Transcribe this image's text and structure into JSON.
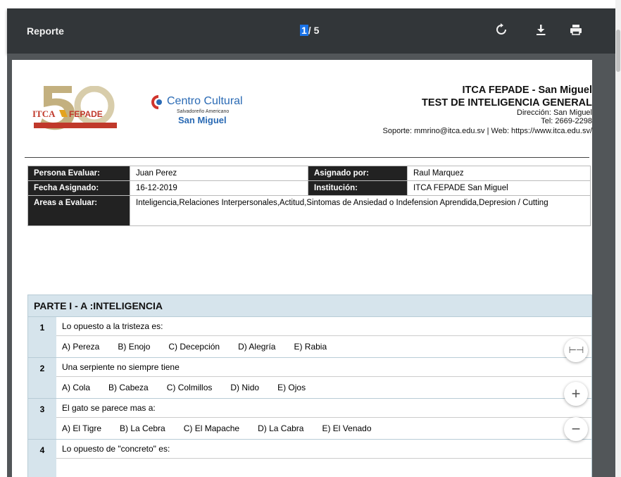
{
  "toolbar": {
    "title": "Reporte",
    "current_page": "1",
    "total_pages": "/ 5"
  },
  "header": {
    "logo1_text": "ITCA FEPADE",
    "logo2_line1": "Centro Cultural",
    "logo2_line2": "Salvadoreño Americano",
    "logo2_line3": "San Miguel",
    "org": "ITCA FEPADE - San Miguel",
    "test": "TEST DE INTELIGENCIA GENERAL",
    "address": "Dirección: San Miguel",
    "tel": "Tel: 2669-2298",
    "support": "Soporte: mmrino@itca.edu.sv | Web: https://www.itca.edu.sv/"
  },
  "info": {
    "persona_label": "Persona Evaluar:",
    "persona_value": "Juan Perez",
    "asignado_label": "Asignado por:",
    "asignado_value": "Raul Marquez",
    "fecha_label": "Fecha Asignado:",
    "fecha_value": "16-12-2019",
    "institucion_label": "Institución:",
    "institucion_value": "ITCA FEPADE San Miguel",
    "areas_label": "Areas a Evaluar:",
    "areas_value": "Inteligencia,Relaciones Interpersonales,Actitud,Sintomas de Ansiedad o Indefension Aprendida,Depresion / Cutting"
  },
  "section": {
    "title": "PARTE I - A :INTELIGENCIA",
    "questions": [
      {
        "num": "1",
        "text": "Lo opuesto a la tristeza es:",
        "options": [
          "A) Pereza",
          "B) Enojo",
          "C) Decepción",
          "D) Alegría",
          "E) Rabia"
        ]
      },
      {
        "num": "2",
        "text": "Una serpiente no siempre tiene",
        "options": [
          "A) Cola",
          "B) Cabeza",
          "C) Colmillos",
          "D) Nido",
          "E) Ojos"
        ]
      },
      {
        "num": "3",
        "text": "El gato se parece mas a:",
        "options": [
          "A) El Tigre",
          "B) La Cebra",
          "C) El Mapache",
          "D) La Cabra",
          "E) El Venado"
        ]
      },
      {
        "num": "4",
        "text": "Lo opuesto de \"concreto\" es:",
        "options": []
      }
    ]
  },
  "icons": {
    "rotate": "rotate-icon",
    "download": "download-icon",
    "print": "print-icon",
    "fit": "fit-page-icon",
    "zoom_in": "zoom-in-icon",
    "zoom_out": "zoom-out-icon"
  },
  "colors": {
    "toolbar": "#323639",
    "viewer_bg": "#525659",
    "label_bg": "#222222",
    "section_bg": "#d6e4ec",
    "page_highlight": "#1a73e8"
  }
}
